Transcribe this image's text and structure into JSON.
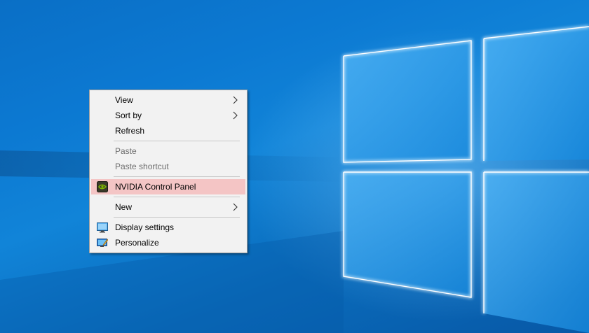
{
  "context_menu": {
    "items": [
      {
        "label": "View",
        "submenu": true,
        "enabled": true
      },
      {
        "label": "Sort by",
        "submenu": true,
        "enabled": true
      },
      {
        "label": "Refresh",
        "submenu": false,
        "enabled": true
      },
      {
        "label": "Paste",
        "submenu": false,
        "enabled": false
      },
      {
        "label": "Paste shortcut",
        "submenu": false,
        "enabled": false
      },
      {
        "label": "NVIDIA Control Panel",
        "submenu": false,
        "enabled": true,
        "icon": "nvidia-icon",
        "highlighted": true
      },
      {
        "label": "New",
        "submenu": true,
        "enabled": true
      },
      {
        "label": "Display settings",
        "submenu": false,
        "enabled": true,
        "icon": "display-icon"
      },
      {
        "label": "Personalize",
        "submenu": false,
        "enabled": true,
        "icon": "personalize-icon"
      }
    ]
  },
  "colors": {
    "menu_background": "#f2f2f2",
    "highlight": "#f4c5c5",
    "disabled_text": "#6d6d6d",
    "wallpaper_blue": "#0c79d2"
  }
}
